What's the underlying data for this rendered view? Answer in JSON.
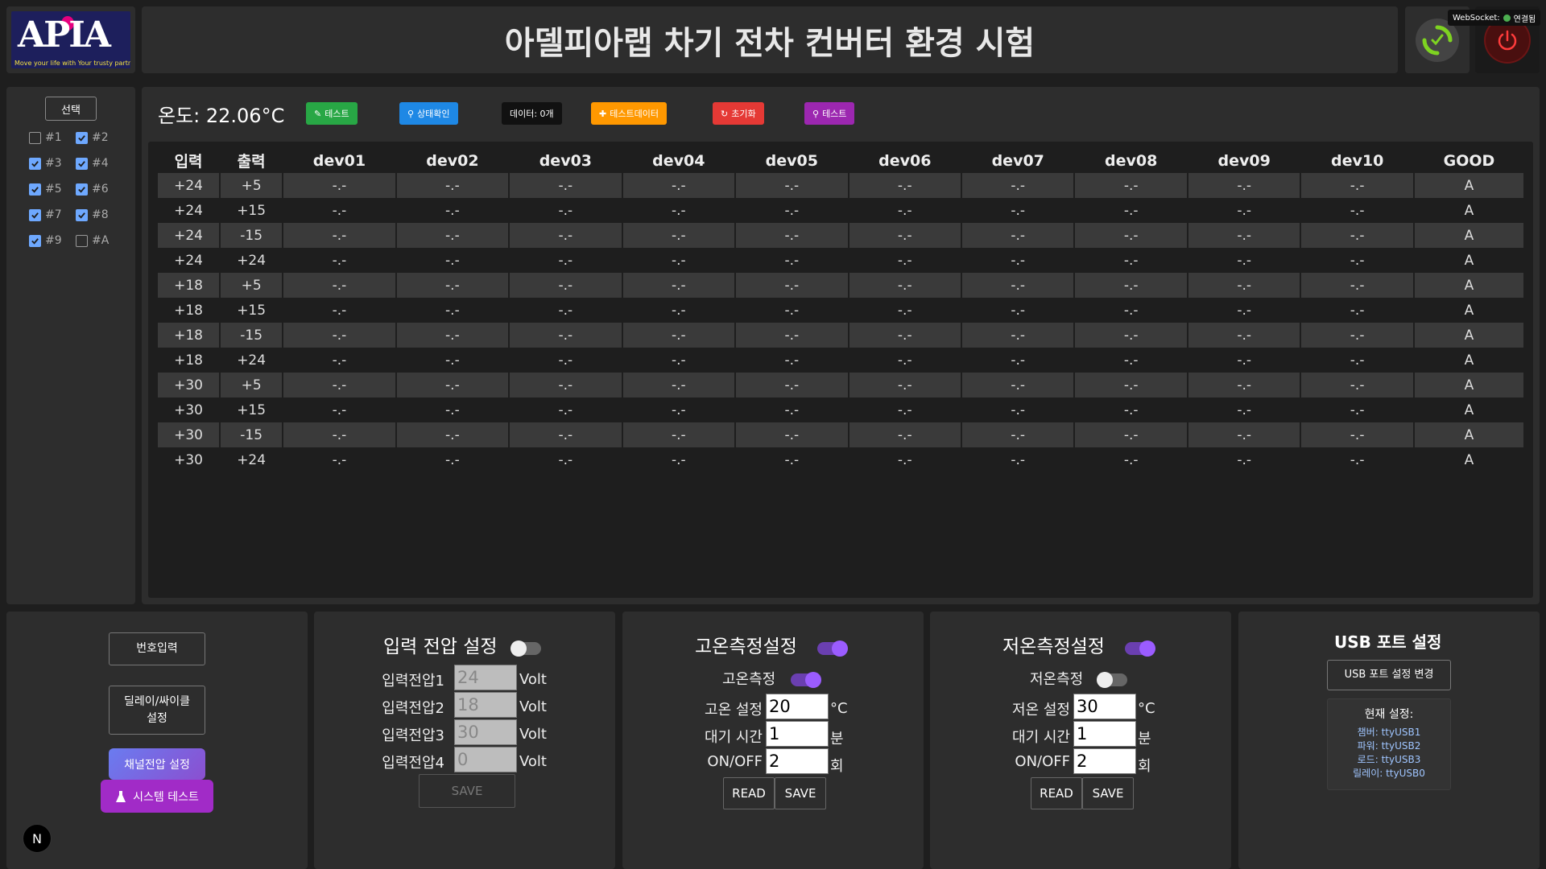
{
  "header": {
    "logo_text": "APIA",
    "logo_tagline": "Move your life with Your trusty partner",
    "title": "아델피아랩 차기 전차 컨버터 환경 시험",
    "websocket_label": "WebSocket:",
    "websocket_status": "연결됨",
    "websocket_color": "#4caf50"
  },
  "sidebar": {
    "select_label": "선택",
    "channels": [
      {
        "label": "#1",
        "checked": false
      },
      {
        "label": "#2",
        "checked": true
      },
      {
        "label": "#3",
        "checked": true
      },
      {
        "label": "#4",
        "checked": true
      },
      {
        "label": "#5",
        "checked": true
      },
      {
        "label": "#6",
        "checked": true
      },
      {
        "label": "#7",
        "checked": true
      },
      {
        "label": "#8",
        "checked": true
      },
      {
        "label": "#9",
        "checked": true
      },
      {
        "label": "#A",
        "checked": false
      }
    ]
  },
  "toolbar": {
    "temperature": "온도: 22.06°C",
    "buttons": [
      {
        "label": "테스트",
        "icon": "pencil-icon",
        "color": "#28a745"
      },
      {
        "label": "상태확인",
        "icon": "search-icon",
        "color": "#1e88e5"
      },
      {
        "label": "데이터: 0개",
        "icon": "",
        "color": "#111111"
      },
      {
        "label": "테스트데이터",
        "icon": "plus-icon",
        "color": "#ff9800"
      },
      {
        "label": "초기화",
        "icon": "refresh-icon",
        "color": "#e53935"
      },
      {
        "label": "테스트",
        "icon": "search-icon",
        "color": "#9c27b0"
      }
    ]
  },
  "table": {
    "headers": [
      "입력",
      "출력",
      "dev01",
      "dev02",
      "dev03",
      "dev04",
      "dev05",
      "dev06",
      "dev07",
      "dev08",
      "dev09",
      "dev10",
      "GOOD"
    ],
    "rows": [
      [
        "+24",
        "+5",
        "-.-",
        "-.-",
        "-.-",
        "-.-",
        "-.-",
        "-.-",
        "-.-",
        "-.-",
        "-.-",
        "-.-",
        "A"
      ],
      [
        "+24",
        "+15",
        "-.-",
        "-.-",
        "-.-",
        "-.-",
        "-.-",
        "-.-",
        "-.-",
        "-.-",
        "-.-",
        "-.-",
        "A"
      ],
      [
        "+24",
        "-15",
        "-.-",
        "-.-",
        "-.-",
        "-.-",
        "-.-",
        "-.-",
        "-.-",
        "-.-",
        "-.-",
        "-.-",
        "A"
      ],
      [
        "+24",
        "+24",
        "-.-",
        "-.-",
        "-.-",
        "-.-",
        "-.-",
        "-.-",
        "-.-",
        "-.-",
        "-.-",
        "-.-",
        "A"
      ],
      [
        "+18",
        "+5",
        "-.-",
        "-.-",
        "-.-",
        "-.-",
        "-.-",
        "-.-",
        "-.-",
        "-.-",
        "-.-",
        "-.-",
        "A"
      ],
      [
        "+18",
        "+15",
        "-.-",
        "-.-",
        "-.-",
        "-.-",
        "-.-",
        "-.-",
        "-.-",
        "-.-",
        "-.-",
        "-.-",
        "A"
      ],
      [
        "+18",
        "-15",
        "-.-",
        "-.-",
        "-.-",
        "-.-",
        "-.-",
        "-.-",
        "-.-",
        "-.-",
        "-.-",
        "-.-",
        "A"
      ],
      [
        "+18",
        "+24",
        "-.-",
        "-.-",
        "-.-",
        "-.-",
        "-.-",
        "-.-",
        "-.-",
        "-.-",
        "-.-",
        "-.-",
        "A"
      ],
      [
        "+30",
        "+5",
        "-.-",
        "-.-",
        "-.-",
        "-.-",
        "-.-",
        "-.-",
        "-.-",
        "-.-",
        "-.-",
        "-.-",
        "A"
      ],
      [
        "+30",
        "+15",
        "-.-",
        "-.-",
        "-.-",
        "-.-",
        "-.-",
        "-.-",
        "-.-",
        "-.-",
        "-.-",
        "-.-",
        "A"
      ],
      [
        "+30",
        "-15",
        "-.-",
        "-.-",
        "-.-",
        "-.-",
        "-.-",
        "-.-",
        "-.-",
        "-.-",
        "-.-",
        "-.-",
        "A"
      ],
      [
        "+30",
        "+24",
        "-.-",
        "-.-",
        "-.-",
        "-.-",
        "-.-",
        "-.-",
        "-.-",
        "-.-",
        "-.-",
        "-.-",
        "A"
      ]
    ]
  },
  "controls": {
    "number_input_label": "번호입력",
    "delay_cycle_label": "딜레이/싸이클\n설정",
    "channel_voltage_label": "채널전압 설정",
    "system_test_label": "시스템 테스트",
    "nav_badge": "N"
  },
  "input_voltage": {
    "title": "입력 전압 설정",
    "toggle_on": false,
    "rows": [
      {
        "label": "입력전압1",
        "value": "24",
        "unit": "Volt"
      },
      {
        "label": "입력전압2",
        "value": "18",
        "unit": "Volt"
      },
      {
        "label": "입력전압3",
        "value": "30",
        "unit": "Volt"
      },
      {
        "label": "입력전압4",
        "value": "0",
        "unit": "Volt"
      }
    ],
    "save_label": "SAVE"
  },
  "high_temp": {
    "title": "고온측정설정",
    "title_toggle_on": true,
    "measure_label": "고온측정",
    "measure_toggle_on": true,
    "rows": [
      {
        "label": "고온 설정",
        "value": "20",
        "unit": "°C"
      },
      {
        "label": "대기 시간",
        "value": "1",
        "unit": "분"
      },
      {
        "label": "ON/OFF",
        "value": "2",
        "unit": "회"
      }
    ],
    "read_label": "READ",
    "save_label": "SAVE"
  },
  "low_temp": {
    "title": "저온측정설정",
    "title_toggle_on": true,
    "measure_label": "저온측정",
    "measure_toggle_on": false,
    "rows": [
      {
        "label": "저온 설정",
        "value": "30",
        "unit": "°C"
      },
      {
        "label": "대기 시간",
        "value": "1",
        "unit": "분"
      },
      {
        "label": "ON/OFF",
        "value": "2",
        "unit": "회"
      }
    ],
    "read_label": "READ",
    "save_label": "SAVE"
  },
  "usb": {
    "title": "USB 포트 설정",
    "change_label": "USB 포트 설정 변경",
    "current_label": "현재 설정:",
    "ports": [
      "챔버: ttyUSB1",
      "파워: ttyUSB2",
      "로드: ttyUSB3",
      "릴레이: ttyUSB0"
    ]
  }
}
